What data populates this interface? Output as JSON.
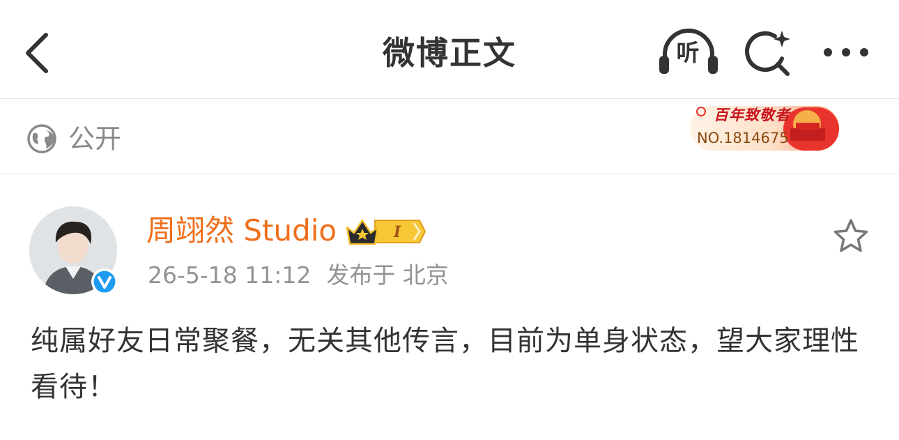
{
  "header": {
    "title": "微博正文",
    "listen_label": "听",
    "back_icon": "chevron-left-icon",
    "search_icon": "search-sparkle-icon",
    "more_icon": "more-dots-icon"
  },
  "visibility": {
    "label": "公开",
    "icon": "globe-icon"
  },
  "fan_badge": {
    "title": "百年致敬者",
    "number": "NO.1814675",
    "colors": {
      "primary": "#e8342c",
      "gold": "#f5b04a"
    }
  },
  "post": {
    "author": "周翊然 Studio",
    "timestamp": "26-5-18 11:12",
    "location": "发布于 北京",
    "text": "纯属好友日常聚餐，无关其他传言，目前为单身状态，望大家理性看待！",
    "vip_level": "I",
    "verified_icon": "verified-v-icon",
    "star_icon": "star-outline-icon"
  },
  "colors": {
    "author_name": "#f06e1a",
    "meta_gray": "#939393",
    "text": "#333333",
    "verified_blue": "#1d9bf0"
  }
}
